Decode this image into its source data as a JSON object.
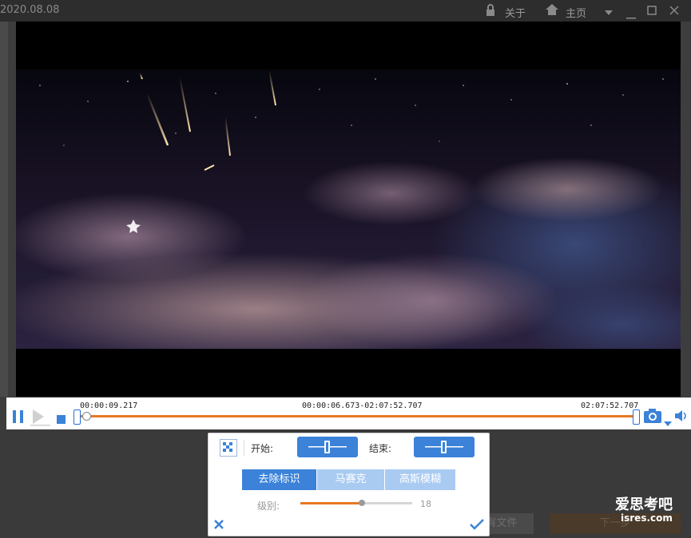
{
  "titlebar": {
    "date": "2020.08.08",
    "about": "关于",
    "home": "主页",
    "icons": [
      "lock-icon",
      "home-icon",
      "menu-arrow-icon",
      "minimize-icon",
      "maximize-icon",
      "close-icon"
    ]
  },
  "timeline": {
    "current_time": "00:00:09.217",
    "range": "00:00:06.673-02:07:52.707",
    "end_time": "02:07:52.707",
    "progress": 0.01,
    "accent_color": "#e87722"
  },
  "panel": {
    "start_label": "开始:",
    "end_label": "结束:",
    "tabs": [
      "去除标识",
      "马赛克",
      "高斯模糊"
    ],
    "active_tab": 0,
    "level_label": "级别:",
    "level_value": "18",
    "level_fraction": 0.55
  },
  "background": {
    "next_file_label": "有文件",
    "next_label": "下一步"
  },
  "watermark": {
    "title": "爱思考吧",
    "site": "isres.com"
  },
  "colors": {
    "blue": "#3b82d8",
    "light_blue": "#a9cbf2",
    "orange": "#e87722"
  }
}
